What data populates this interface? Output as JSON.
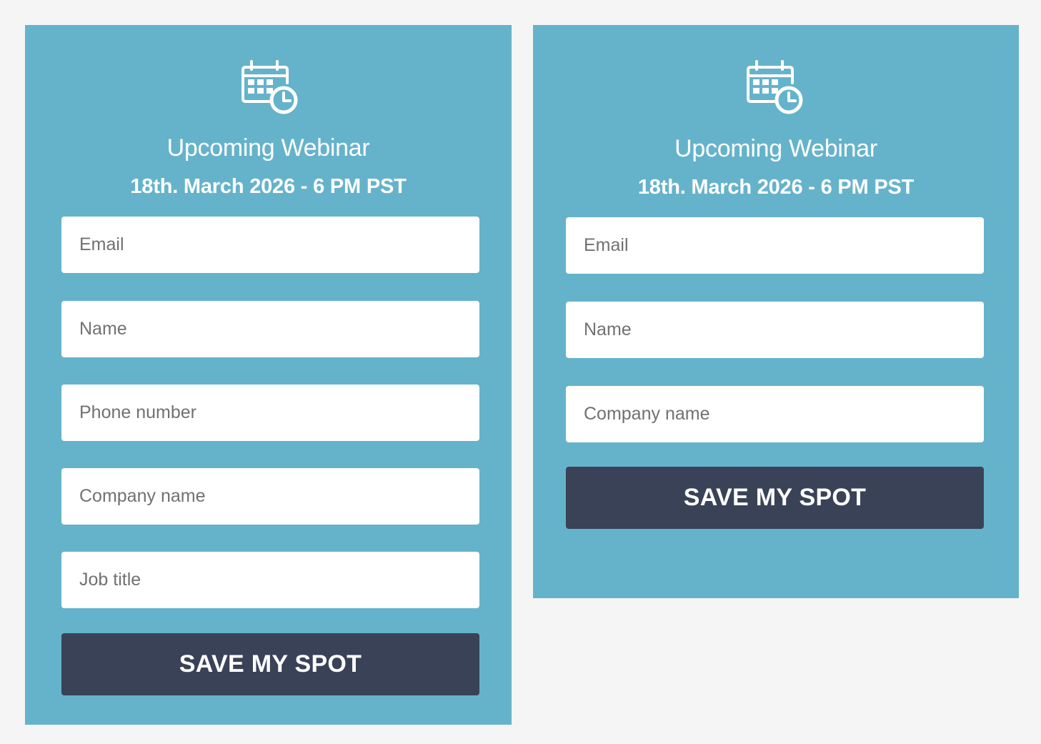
{
  "colors": {
    "page_background": "#f4f5f4",
    "card_background": "#65b3ca",
    "button_background": "#3a4257",
    "text_on_card": "#ffffff",
    "placeholder_text": "#717171"
  },
  "icon": "calendar-clock-icon",
  "forms": [
    {
      "title": "Upcoming Webinar",
      "date": "18th. March 2026 - 6 PM PST",
      "fields": [
        {
          "placeholder": "Email"
        },
        {
          "placeholder": "Name"
        },
        {
          "placeholder": "Phone number"
        },
        {
          "placeholder": "Company name"
        },
        {
          "placeholder": "Job title"
        }
      ],
      "button_label": "SAVE MY SPOT"
    },
    {
      "title": "Upcoming Webinar",
      "date": "18th. March 2026 - 6 PM PST",
      "fields": [
        {
          "placeholder": "Email"
        },
        {
          "placeholder": "Name"
        },
        {
          "placeholder": "Company name"
        }
      ],
      "button_label": "SAVE MY SPOT"
    }
  ]
}
